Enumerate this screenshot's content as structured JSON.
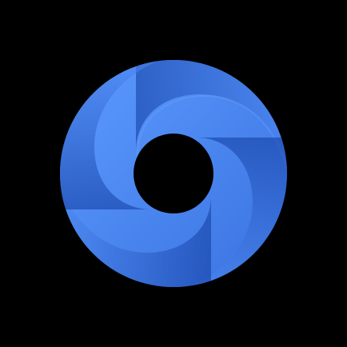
{
  "logo": {
    "icon": "swirl-ring-logo-icon",
    "colors": {
      "background": "#000000",
      "light_blue": "#5c9bff",
      "mid_blue": "#3a72e0",
      "dark_blue": "#0f3a9e",
      "hole": "#000000"
    }
  }
}
